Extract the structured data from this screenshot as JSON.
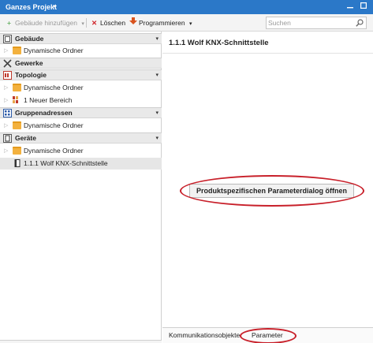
{
  "window": {
    "title": "Ganzes Projekt",
    "title_caret": "▾"
  },
  "toolbar": {
    "add_building": "Gebäude hinzufügen",
    "delete": "Löschen",
    "program": "Programmieren",
    "search_placeholder": "Suchen"
  },
  "tree": {
    "sections": [
      {
        "label": "Gebäude",
        "icon": "building-icon"
      },
      {
        "label": "Gewerke",
        "icon": "tools-icon"
      },
      {
        "label": "Topologie",
        "icon": "topology-icon"
      },
      {
        "label": "Gruppenadressen",
        "icon": "group-address-icon"
      },
      {
        "label": "Geräte",
        "icon": "device-icon"
      }
    ],
    "items": [
      {
        "label": "Dynamische Ordner",
        "icon": "folder-icon"
      },
      {
        "label": "Dynamische Ordner",
        "icon": "folder-icon"
      },
      {
        "label": "1 Neuer Bereich",
        "icon": "area-icon"
      },
      {
        "label": "Dynamische Ordner",
        "icon": "folder-icon"
      },
      {
        "label": "Dynamische Ordner",
        "icon": "folder-icon"
      },
      {
        "label": "1.1.1 Wolf KNX-Schnittstelle",
        "icon": "device-icon"
      }
    ]
  },
  "detail": {
    "title": "1.1.1 Wolf KNX-Schnittstelle",
    "param_button": "Produktspezifischen Parameterdialog öffnen"
  },
  "tabs": {
    "items": [
      "Kommunikationsobjekte",
      "Parameter"
    ],
    "active": "Parameter"
  },
  "colors": {
    "titlebar": "#2b78c8",
    "highlight_ellipse": "#c8202a",
    "folder": "#f3b13e"
  }
}
